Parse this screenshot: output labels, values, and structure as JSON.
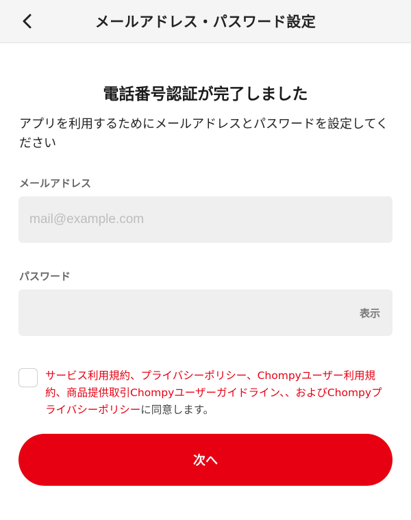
{
  "header": {
    "title": "メールアドレス・パスワード設定",
    "back_icon": "chevron-left-icon"
  },
  "main": {
    "title": "電話番号認証が完了しました",
    "lead": "アプリを利用するためにメールアドレスとパスワードを設定してください"
  },
  "email": {
    "label": "メールアドレス",
    "value": "",
    "placeholder": "mail@example.com"
  },
  "password": {
    "label": "パスワード",
    "value": "",
    "placeholder": "",
    "show_label": "表示"
  },
  "terms": {
    "checked": false,
    "link_service": "サービス利用規約",
    "sep1": "、",
    "link_privacy": "プライバシーポリシー",
    "sep2": "、",
    "link_user_terms": "Chompyユーザー利用規約",
    "sep3": "、",
    "link_commerce": "商品提供取引",
    "link_guideline": "Chompyユーザーガイドライン",
    "sep4": "、、および",
    "link_chompy_privacy": "Chompyプライバシーポリシー",
    "suffix": "に同意します。"
  },
  "actions": {
    "next_label": "次へ"
  },
  "colors": {
    "accent": "#e60012",
    "header_bg": "#f5f5f5",
    "input_bg": "#efefef"
  }
}
